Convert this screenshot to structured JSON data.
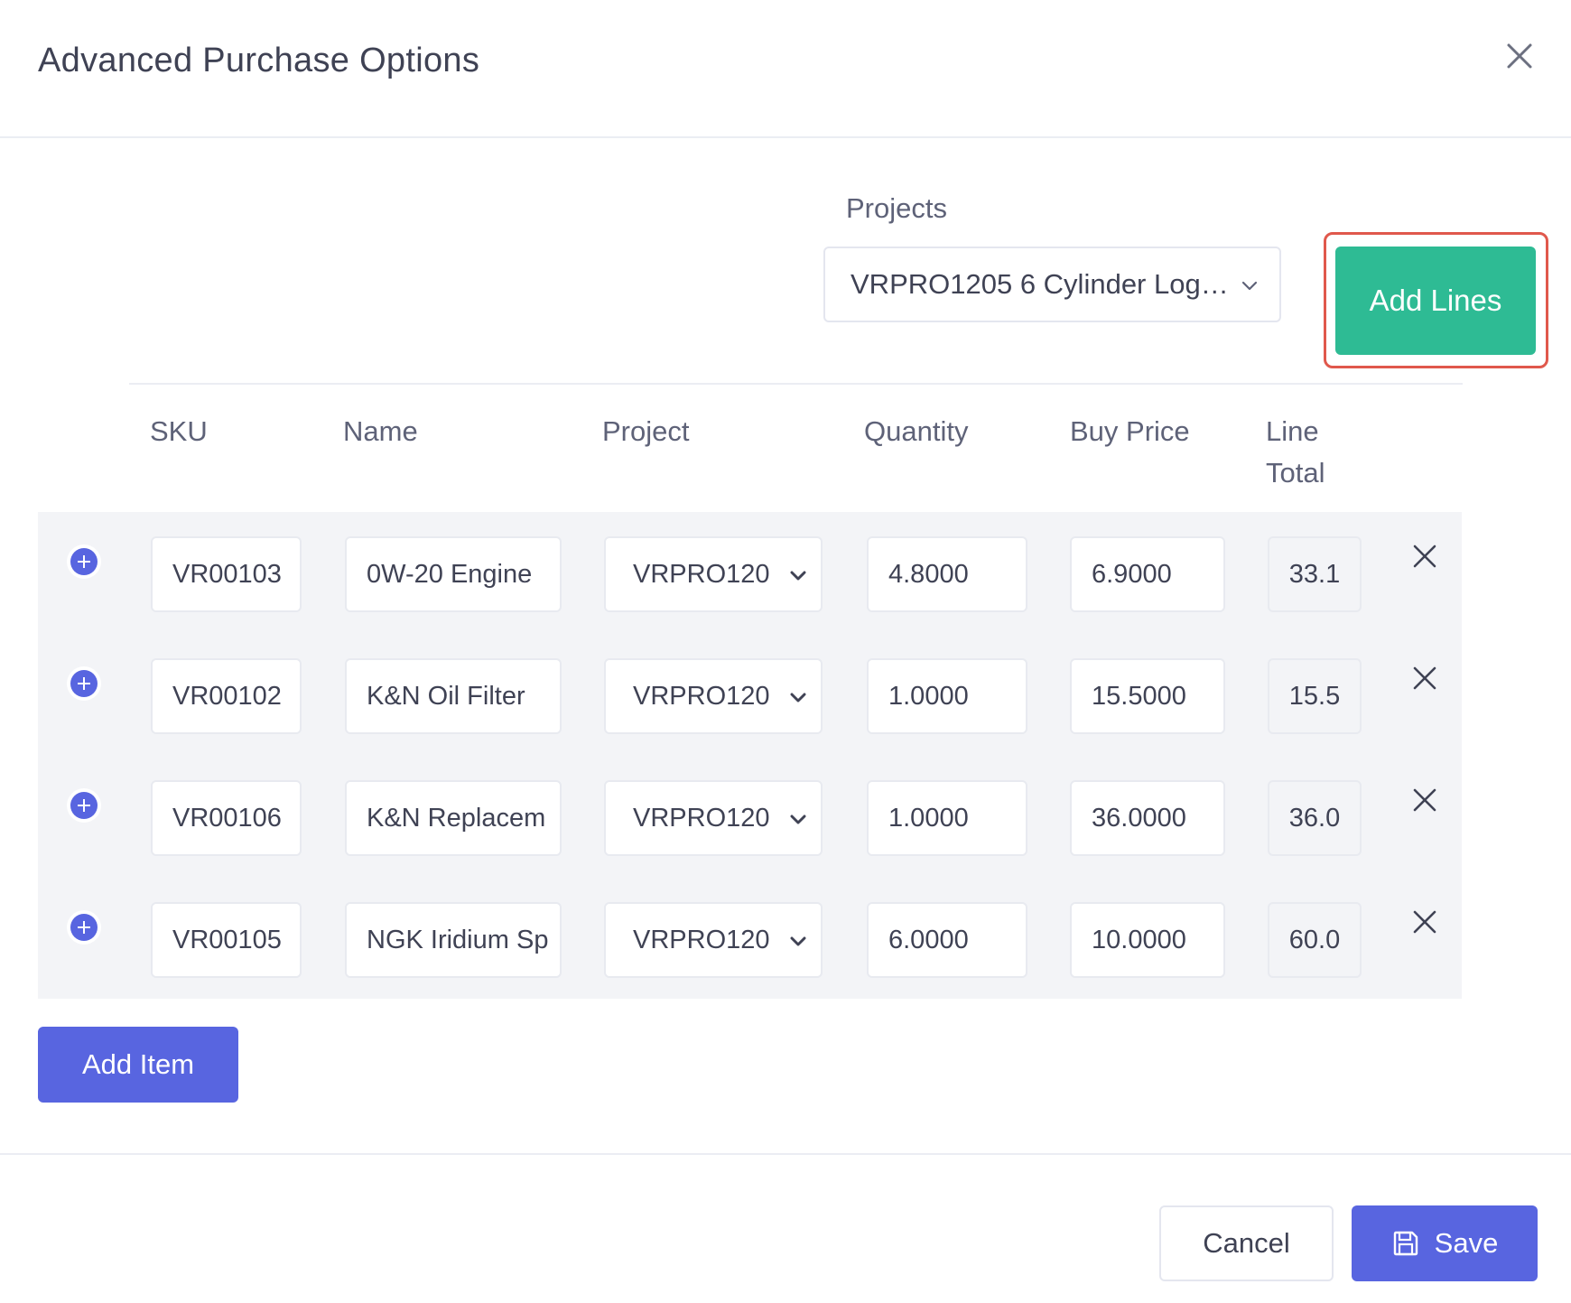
{
  "modal": {
    "title": "Advanced Purchase Options"
  },
  "projects": {
    "label": "Projects",
    "selected": "VRPRO1205 6 Cylinder Log…"
  },
  "add_lines_label": "Add Lines",
  "table": {
    "headers": {
      "sku": "SKU",
      "name": "Name",
      "project": "Project",
      "quantity": "Quantity",
      "buy_price": "Buy Price",
      "line_total": "Line Total"
    },
    "rows": [
      {
        "sku": "VR00103",
        "name": "0W-20 Engine",
        "project": "VRPRO120",
        "quantity": "4.8000",
        "buy_price": "6.9000",
        "line_total": "33.1"
      },
      {
        "sku": "VR00102",
        "name": "K&N Oil Filter",
        "project": "VRPRO120",
        "quantity": "1.0000",
        "buy_price": "15.5000",
        "line_total": "15.5"
      },
      {
        "sku": "VR00106",
        "name": "K&N Replacem",
        "project": "VRPRO120",
        "quantity": "1.0000",
        "buy_price": "36.0000",
        "line_total": "36.0"
      },
      {
        "sku": "VR00105",
        "name": "NGK Iridium Sp",
        "project": "VRPRO120",
        "quantity": "6.0000",
        "buy_price": "10.0000",
        "line_total": "60.0"
      }
    ]
  },
  "footer": {
    "add_item_label": "Add Item",
    "cancel_label": "Cancel",
    "save_label": "Save"
  },
  "colors": {
    "accent_green": "#2ebb94",
    "accent_blue": "#5865e0",
    "highlight_red": "#e0584c"
  },
  "icons": {
    "close": "close-icon",
    "chevron": "chevron-down-icon",
    "add_row": "plus-circle-icon",
    "remove_row": "close-icon",
    "save": "floppy-disk-icon"
  }
}
